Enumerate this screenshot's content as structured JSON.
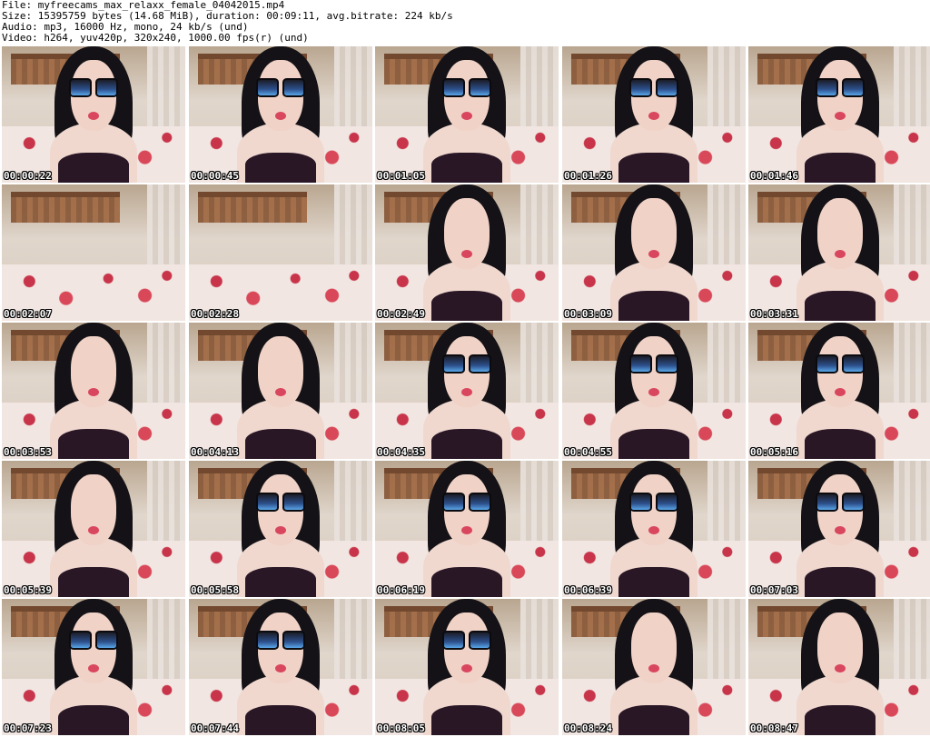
{
  "header": {
    "file": "File: myfreecams_max_relaxx_female_04042015.mp4",
    "size": "Size: 15395759 bytes (14.68 MiB), duration: 00:09:11, avg.bitrate: 224 kb/s",
    "audio": "Audio: mp3, 16000 Hz, mono, 24 kb/s (und)",
    "video": "Video: h264, yuv420p, 320x240, 1000.00 fps(r) (und)"
  },
  "thumbnails": [
    {
      "time": "00:00:22",
      "glasses": true,
      "scene": "person"
    },
    {
      "time": "00:00:45",
      "glasses": true,
      "scene": "person"
    },
    {
      "time": "00:01:05",
      "glasses": true,
      "scene": "person"
    },
    {
      "time": "00:01:26",
      "glasses": true,
      "scene": "person"
    },
    {
      "time": "00:01:46",
      "glasses": true,
      "scene": "person"
    },
    {
      "time": "00:02:07",
      "glasses": false,
      "scene": "bed"
    },
    {
      "time": "00:02:28",
      "glasses": false,
      "scene": "bed"
    },
    {
      "time": "00:02:49",
      "glasses": false,
      "scene": "person"
    },
    {
      "time": "00:03:09",
      "glasses": false,
      "scene": "person"
    },
    {
      "time": "00:03:31",
      "glasses": false,
      "scene": "person"
    },
    {
      "time": "00:03:53",
      "glasses": false,
      "scene": "person"
    },
    {
      "time": "00:04:13",
      "glasses": false,
      "scene": "person"
    },
    {
      "time": "00:04:35",
      "glasses": true,
      "scene": "person"
    },
    {
      "time": "00:04:55",
      "glasses": true,
      "scene": "person"
    },
    {
      "time": "00:05:16",
      "glasses": true,
      "scene": "person"
    },
    {
      "time": "00:05:39",
      "glasses": false,
      "scene": "person"
    },
    {
      "time": "00:05:58",
      "glasses": true,
      "scene": "person"
    },
    {
      "time": "00:06:19",
      "glasses": true,
      "scene": "person"
    },
    {
      "time": "00:06:39",
      "glasses": true,
      "scene": "person"
    },
    {
      "time": "00:07:03",
      "glasses": true,
      "scene": "person"
    },
    {
      "time": "00:07:23",
      "glasses": true,
      "scene": "person"
    },
    {
      "time": "00:07:44",
      "glasses": true,
      "scene": "person"
    },
    {
      "time": "00:08:05",
      "glasses": true,
      "scene": "person"
    },
    {
      "time": "00:08:24",
      "glasses": false,
      "scene": "person"
    },
    {
      "time": "00:08:47",
      "glasses": false,
      "scene": "person"
    }
  ]
}
